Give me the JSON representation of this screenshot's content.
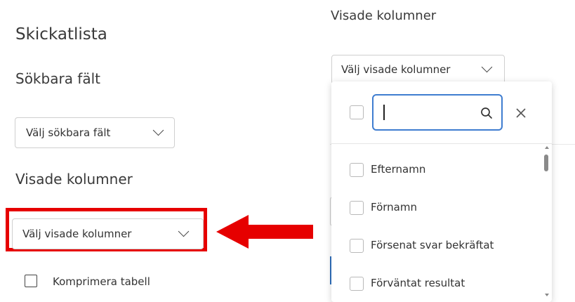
{
  "left": {
    "title": "Skickatlista",
    "searchable_fields_heading": "Sökbara fält",
    "searchable_fields_placeholder": "Välj sökbara fält",
    "visible_columns_heading": "Visade kolumner",
    "visible_columns_placeholder": "Välj visade kolumner",
    "compress_table_label": "Komprimera tabell"
  },
  "right": {
    "visible_columns_heading": "Visade kolumner",
    "visible_columns_placeholder": "Välj visade kolumner",
    "search_value": "",
    "options": [
      {
        "label": "Efternamn",
        "checked": false
      },
      {
        "label": "Förnamn",
        "checked": false
      },
      {
        "label": "Försenat svar bekräftat",
        "checked": false
      },
      {
        "label": "Förväntat resultat",
        "checked": false
      }
    ]
  },
  "colors": {
    "highlight": "#e60000",
    "accent_blue": "#2f6fbd",
    "border": "#cfcfcf"
  },
  "icons": [
    "chevron-down-icon",
    "search-icon",
    "close-icon",
    "arrow-left-icon",
    "checkbox-icon"
  ]
}
